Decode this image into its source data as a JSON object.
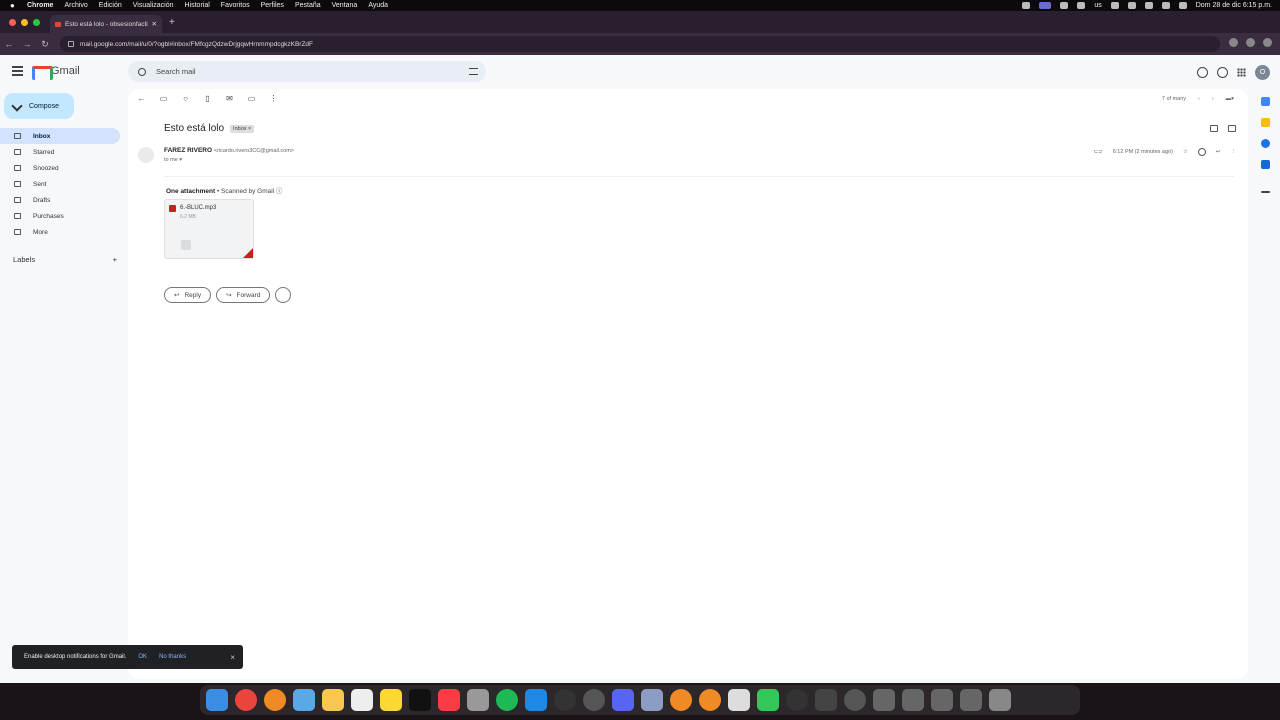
{
  "menubar": {
    "app": "Chrome",
    "items": [
      "Archivo",
      "Edición",
      "Visualización",
      "Historial",
      "Favoritos",
      "Perfiles",
      "Pestaña",
      "Ventana",
      "Ayuda"
    ],
    "input_source": "us",
    "clock": "Dom 28 de dic 6:15 p.m."
  },
  "browser": {
    "tab_title": "Esto está lolo - obsesionfacti",
    "url": "mail.google.com/mail/u/0/?ogbl#inbox/FMfcgzQdzwDrjgqwHrnmmpdcgkzKBrZdF"
  },
  "gmail": {
    "app_name": "Gmail",
    "search_placeholder": "Search mail",
    "avatar_letter": "O",
    "compose_label": "Compose",
    "nav": [
      {
        "label": "Inbox",
        "active": true
      },
      {
        "label": "Starred",
        "active": false
      },
      {
        "label": "Snoozed",
        "active": false
      },
      {
        "label": "Sent",
        "active": false
      },
      {
        "label": "Drafts",
        "active": false
      },
      {
        "label": "Purchases",
        "active": false
      },
      {
        "label": "More",
        "active": false
      }
    ],
    "labels_heading": "Labels",
    "labels_add": "+",
    "pager": "7 of many",
    "email": {
      "subject": "Esto está lolo",
      "label_chip": "Inbox ×",
      "sender_name": "FAREZ RIVERO",
      "sender_email": "<ricardo.rivero3CC@gmail.com>",
      "to": "to me ▾",
      "time": "6:12 PM (2 minutes ago)",
      "attachment_heading": "One attachment",
      "scanned": "• Scanned by Gmail ⓘ",
      "attachment_name": "6.-BLUC.mp3",
      "attachment_size": "6.2 MB",
      "reply_label": "Reply",
      "forward_label": "Forward"
    }
  },
  "toast": {
    "message": "Enable desktop notifications for Gmail.",
    "ok": "OK",
    "no_thanks": "No thanks",
    "close": "×"
  },
  "colors": {
    "compose_bg": "#c2e7ff",
    "active_nav": "#d3e3fd",
    "gmail_red": "#ea4335",
    "link_blue": "#8ab4f8"
  }
}
